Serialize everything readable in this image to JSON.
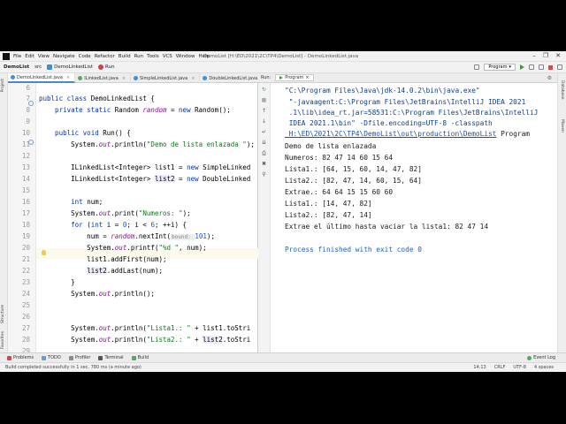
{
  "menu": {
    "items": [
      "File",
      "Edit",
      "View",
      "Navigate",
      "Code",
      "Refactor",
      "Build",
      "Run",
      "Tools",
      "VCS",
      "Window",
      "Help"
    ],
    "title": "DemoList [H:\\ED\\2021\\2C\\TP4\\DemoList] - DemoLinkedList.java",
    "controls": [
      "–",
      "❐",
      "✕"
    ]
  },
  "nav": {
    "project": "DemoList",
    "src": "src",
    "cls": "DemoLinkedList",
    "method": "Run",
    "runconfig": "Program"
  },
  "editor": {
    "tabs": [
      {
        "label": "DemoLinkedList.java",
        "color": "#3d8fd6"
      },
      {
        "label": "ILinkedList.java",
        "color": "#5aa860"
      },
      {
        "label": "SimpleLinkedList.java",
        "color": "#3d8fd6"
      },
      {
        "label": "DoubleLinkedList.java",
        "color": "#3d8fd6"
      }
    ],
    "line_numbers": [
      "6",
      "7",
      "8",
      "9",
      "10",
      "11",
      "12",
      "13",
      "14",
      "15",
      "16",
      "17",
      "18",
      "19",
      "20",
      "21",
      "22",
      "23",
      "24",
      "25",
      "26",
      "27",
      "28",
      "29",
      "30"
    ],
    "code": {
      "l7_a": "public class ",
      "l7_b": "DemoLinkedList {",
      "l8_a": "    private static ",
      "l8_b": "Random ",
      "l8_c": "random",
      "l8_d": " = ",
      "l8_e": "new ",
      "l8_f": "Random();",
      "l10_a": "    public void ",
      "l10_b": "Run() {",
      "l11_a": "        System.",
      "l11_b": "out",
      "l11_c": ".println(",
      "l11_d": "\"Demo de lista enlazada \"",
      "l11_e": ");",
      "l13_a": "        ILinkedList<Integer> list1 = ",
      "l13_b": "new ",
      "l13_c": "SimpleLinked",
      "l14_a": "        ILinkedList<Integer> ",
      "l14_b": "list2",
      "l14_c": " = ",
      "l14_d": "new ",
      "l14_e": "DoubleLinked",
      "l16_a": "        ",
      "l16_b": "int ",
      "l16_c": "num;",
      "l17_a": "        System.",
      "l17_b": "out",
      "l17_c": ".print(",
      "l17_d": "\"Numeros: \"",
      "l17_e": ");",
      "l18_a": "        ",
      "l18_b": "for ",
      "l18_c": "(",
      "l18_d": "int ",
      "l18_e": "i = ",
      "l18_f": "0",
      "l18_g": "; i < ",
      "l18_h": "6",
      "l18_i": "; ++i) {",
      "l19_a": "            num = ",
      "l19_b": "random",
      "l19_c": ".nextInt(",
      "l19_d": "bound: ",
      "l19_e": "101",
      "l19_f": ");",
      "l20_a": "            System.",
      "l20_b": "out",
      "l20_c": ".printf(",
      "l20_d": "\"%d \"",
      "l20_e": ", num);",
      "l21": "            list1.addFirst(num);",
      "l22_a": "            ",
      "l22_b": "list2",
      "l22_c": ".addLast(num);",
      "l23": "        }",
      "l24_a": "        System.",
      "l24_b": "out",
      "l24_c": ".println();",
      "l27_a": "        System.",
      "l27_b": "out",
      "l27_c": ".println(",
      "l27_d": "\"Lista1.: \"",
      "l27_e": " + list1.",
      "l27_f": "toStri",
      "l28_a": "        System.",
      "l28_b": "out",
      "l28_c": ".println(",
      "l28_d": "\"Lista2.: \"",
      "l28_e": " + ",
      "l28_f": "list2",
      "l28_g": ".toStri"
    }
  },
  "run": {
    "label": "Run:",
    "tab": "Program",
    "output": [
      "\"C:\\Program Files\\Java\\jdk-14.0.2\\bin\\java.exe\"",
      " \"-javaagent:C:\\Program Files\\JetBrains\\IntelliJ IDEA 2021",
      " .1\\lib\\idea_rt.jar=58531:C:\\Program Files\\JetBrains\\IntelliJ",
      " IDEA 2021.1\\bin\" -Dfile.encoding=UTF-8 -classpath",
      " H:\\ED\\2021\\2C\\TP4\\DemoList\\out\\production\\DemoList",
      "Demo de lista enlazada",
      "Numeros: 82 47 14 60 15 64",
      "Lista1.: [64, 15, 60, 14, 47, 82]",
      "Lista2.: [82, 47, 14, 60, 15, 64]",
      "Extrae.: 64 64 15 15 60 60",
      "Lista1.: [14, 47, 82]",
      "Lista2.: [82, 47, 14]",
      "Extrae el último hasta vaciar la lista1: 82 47 14",
      "Process finished with exit code 0"
    ],
    "program_tail": "Program"
  },
  "toolwindows": {
    "bottom": [
      "Problems",
      "TODO",
      "Profiler",
      "Terminal",
      "Build"
    ],
    "event_log": "Event Log",
    "left": [
      "Project",
      "Structure",
      "Favorites"
    ],
    "right": [
      "Database",
      "Maven"
    ]
  },
  "status": {
    "message": "Build completed successfully in 1 sec, 780 ms (a minute ago)",
    "position": "14:13",
    "line_sep": "CRLF",
    "encoding": "UTF-8",
    "indent": "4 spaces"
  }
}
